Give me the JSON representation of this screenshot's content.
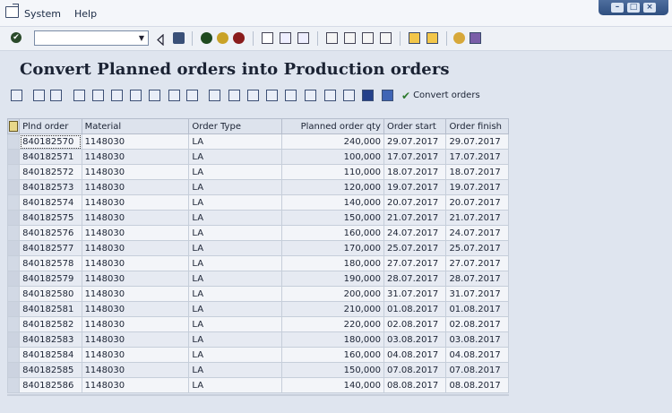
{
  "menu": {
    "system": "System",
    "help": "Help"
  },
  "command_field": {
    "value": "",
    "placeholder": ""
  },
  "title": "Convert Planned orders into Production orders",
  "app_toolbar": {
    "convert_label": "Convert orders"
  },
  "table": {
    "columns": [
      "Plnd order",
      "Material",
      "Order Type",
      "Planned order qty",
      "Order start",
      "Order finish"
    ],
    "rows": [
      [
        "840182570",
        "1148030",
        "LA",
        "240,000",
        "29.07.2017",
        "29.07.2017"
      ],
      [
        "840182571",
        "1148030",
        "LA",
        "100,000",
        "17.07.2017",
        "17.07.2017"
      ],
      [
        "840182572",
        "1148030",
        "LA",
        "110,000",
        "18.07.2017",
        "18.07.2017"
      ],
      [
        "840182573",
        "1148030",
        "LA",
        "120,000",
        "19.07.2017",
        "19.07.2017"
      ],
      [
        "840182574",
        "1148030",
        "LA",
        "140,000",
        "20.07.2017",
        "20.07.2017"
      ],
      [
        "840182575",
        "1148030",
        "LA",
        "150,000",
        "21.07.2017",
        "21.07.2017"
      ],
      [
        "840182576",
        "1148030",
        "LA",
        "160,000",
        "24.07.2017",
        "24.07.2017"
      ],
      [
        "840182577",
        "1148030",
        "LA",
        "170,000",
        "25.07.2017",
        "25.07.2017"
      ],
      [
        "840182578",
        "1148030",
        "LA",
        "180,000",
        "27.07.2017",
        "27.07.2017"
      ],
      [
        "840182579",
        "1148030",
        "LA",
        "190,000",
        "28.07.2017",
        "28.07.2017"
      ],
      [
        "840182580",
        "1148030",
        "LA",
        "200,000",
        "31.07.2017",
        "31.07.2017"
      ],
      [
        "840182581",
        "1148030",
        "LA",
        "210,000",
        "01.08.2017",
        "01.08.2017"
      ],
      [
        "840182582",
        "1148030",
        "LA",
        "220,000",
        "02.08.2017",
        "02.08.2017"
      ],
      [
        "840182583",
        "1148030",
        "LA",
        "180,000",
        "03.08.2017",
        "03.08.2017"
      ],
      [
        "840182584",
        "1148030",
        "LA",
        "160,000",
        "04.08.2017",
        "04.08.2017"
      ],
      [
        "840182585",
        "1148030",
        "LA",
        "150,000",
        "07.08.2017",
        "07.08.2017"
      ],
      [
        "840182586",
        "1148030",
        "LA",
        "140,000",
        "08.08.2017",
        "08.08.2017"
      ]
    ]
  },
  "colors": {
    "background": "#dfe5ef",
    "title_bar": "#2f4f80",
    "accent_green": "#2d7a2d"
  }
}
